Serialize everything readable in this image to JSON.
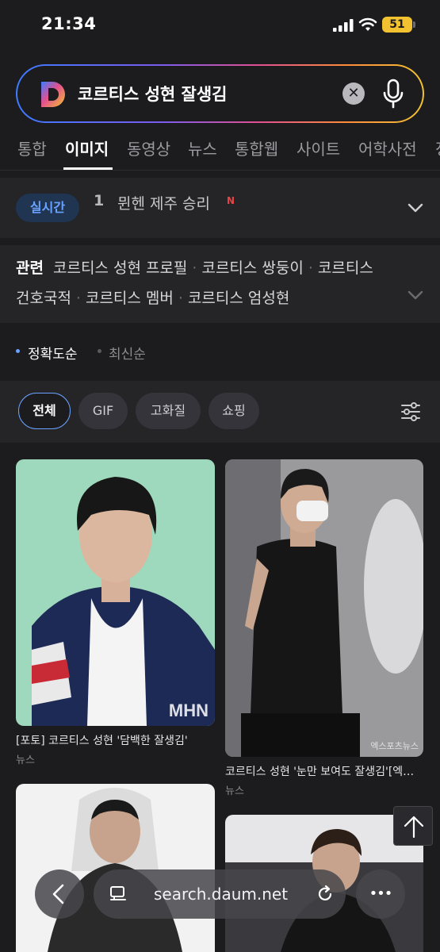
{
  "status_bar": {
    "time": "21:34",
    "battery": "51"
  },
  "search": {
    "query": "코르티스 성현 잘생김",
    "clear_label": "✕"
  },
  "tabs": [
    {
      "label": "통합"
    },
    {
      "label": "이미지"
    },
    {
      "label": "동영상"
    },
    {
      "label": "뉴스"
    },
    {
      "label": "통합웹"
    },
    {
      "label": "사이트"
    },
    {
      "label": "어학사전"
    },
    {
      "label": "정"
    }
  ],
  "realtime": {
    "badge": "실시간",
    "rank": "1",
    "text": "뮌헨 제주 승리",
    "new_label": "N"
  },
  "related": {
    "heading": "관련",
    "items": [
      "코르티스 성현 프로필",
      "코르티스 쌍둥이",
      "코르티스",
      "건호국적",
      "코르티스 멤버",
      "코르티스 엄성현"
    ]
  },
  "sort": {
    "options": [
      "정확도순",
      "최신순"
    ],
    "selected": "정확도순"
  },
  "filters": [
    {
      "label": "전체"
    },
    {
      "label": "GIF"
    },
    {
      "label": "고화질"
    },
    {
      "label": "쇼핑"
    }
  ],
  "results": [
    {
      "caption": "[포토] 코르티스 성현 '담백한 잘생김'",
      "source": "뉴스",
      "watermark": "MHN"
    },
    {
      "caption": "코르티스 성현 '눈만 보여도 잘생김'[엑스포츠뉴스]",
      "source": "뉴스",
      "watermark": "엑스포츠뉴스"
    },
    {
      "caption": "",
      "source": ""
    },
    {
      "caption": "",
      "source": ""
    }
  ],
  "browser": {
    "url": "search.daum.net",
    "more_label": "•••"
  },
  "colors": {
    "accent": "#6aa3ff",
    "background": "#1c1c1e",
    "panel": "#252528",
    "battery": "#f2c230"
  }
}
